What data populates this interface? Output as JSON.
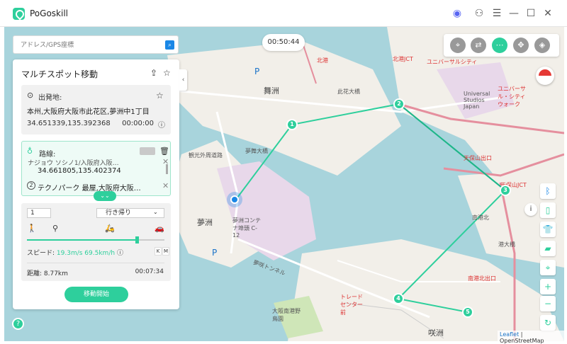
{
  "app": {
    "title": "PoGoskill"
  },
  "search": {
    "placeholder": "アドレス/GPS座標"
  },
  "timer": "00:50:44",
  "panel": {
    "title": "マルチスポット移動",
    "start": {
      "label": "出発地:",
      "address": "本州,大阪府大阪市此花区,夢洲中1丁目",
      "coords": "34.651339,135.392368",
      "time": "00:00:00"
    },
    "route": {
      "label": "路線:",
      "partial_line": "ナジョウ ソシノ1/入阪府入阪…",
      "coords": "34.661805,135.402374",
      "dest_num": "2",
      "dest": "テクノパーク 最屋,大阪府大阪…"
    },
    "settings": {
      "count": "1",
      "round_trip": "行き帰り",
      "speed_label": "スピード:",
      "speed_value": "19.3m/s 69.5km/h",
      "distance": "距離: 8.77km",
      "duration": "00:07:34",
      "speed_fraction": 0.8
    },
    "start_button": "移動開始"
  },
  "map_labels": {
    "maishima": "舞洲",
    "yumeshima": "夢洲",
    "sakishima": "咲洲",
    "yume_bridge": "夢舞大橋",
    "hokko_bridge": "此花大橋",
    "harbor": "港大橋",
    "tunnel": "夢咲トンネル",
    "container": "夢洲コンテナ埠頭 C-12",
    "kanki": "観光外周道路",
    "usj": "Universal Studios Japan",
    "usj_station": "ユニバーサルシティ",
    "usj_ct": "北港JCT",
    "usj_2": "ユニバーサル・シティウォーク",
    "center": "トレードセンター前",
    "park": "大阪南港野鳥園",
    "tempozan": "天保山出口",
    "tempo_jct": "天保山JCT",
    "nanko": "南港北",
    "nankoguchi": "南港北出口",
    "north_port": "北港",
    "p_label": "P"
  },
  "waypoints": [
    "1",
    "2",
    "3",
    "4",
    "5"
  ],
  "attribution": {
    "leaflet": "Leaflet",
    "osm": "| OpenStreetMap"
  }
}
